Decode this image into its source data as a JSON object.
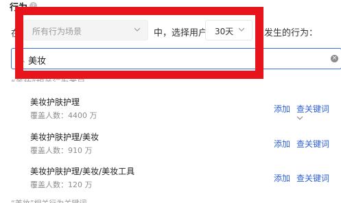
{
  "section": {
    "title": "行为",
    "help_icon": "question-circle-icon"
  },
  "filter": {
    "left_cut_text": "在",
    "scene_select": {
      "value": "所有行为场景"
    },
    "middle_text": "中，选择用户",
    "duration_select": {
      "value": "30天"
    },
    "suffix_text": "内发生的行为："
  },
  "search": {
    "value": "美妆",
    "icon": "search-icon",
    "clear_icon": "clear-circle-icon"
  },
  "results_header_cut": "“美妆”相关行为类目",
  "results": [
    {
      "name": "美妆护肤护理",
      "coverage": "覆盖人数：4400 万",
      "add_label": "添加",
      "keywords_label": "查关键词"
    },
    {
      "name": "美妆护肤护理/美妆",
      "coverage": "覆盖人数：910 万",
      "add_label": "添加",
      "keywords_label": "查关键词"
    },
    {
      "name": "美妆护肤护理/美妆/美妆工具",
      "coverage": "覆盖人数：120 万",
      "add_label": "添加",
      "keywords_label": "查关键词"
    }
  ],
  "bottom_cut_text": "“美妆”相关行为关键词",
  "colors": {
    "accent": "#3a6fde",
    "link": "#2f61d5",
    "annotation": "#e8141c"
  }
}
